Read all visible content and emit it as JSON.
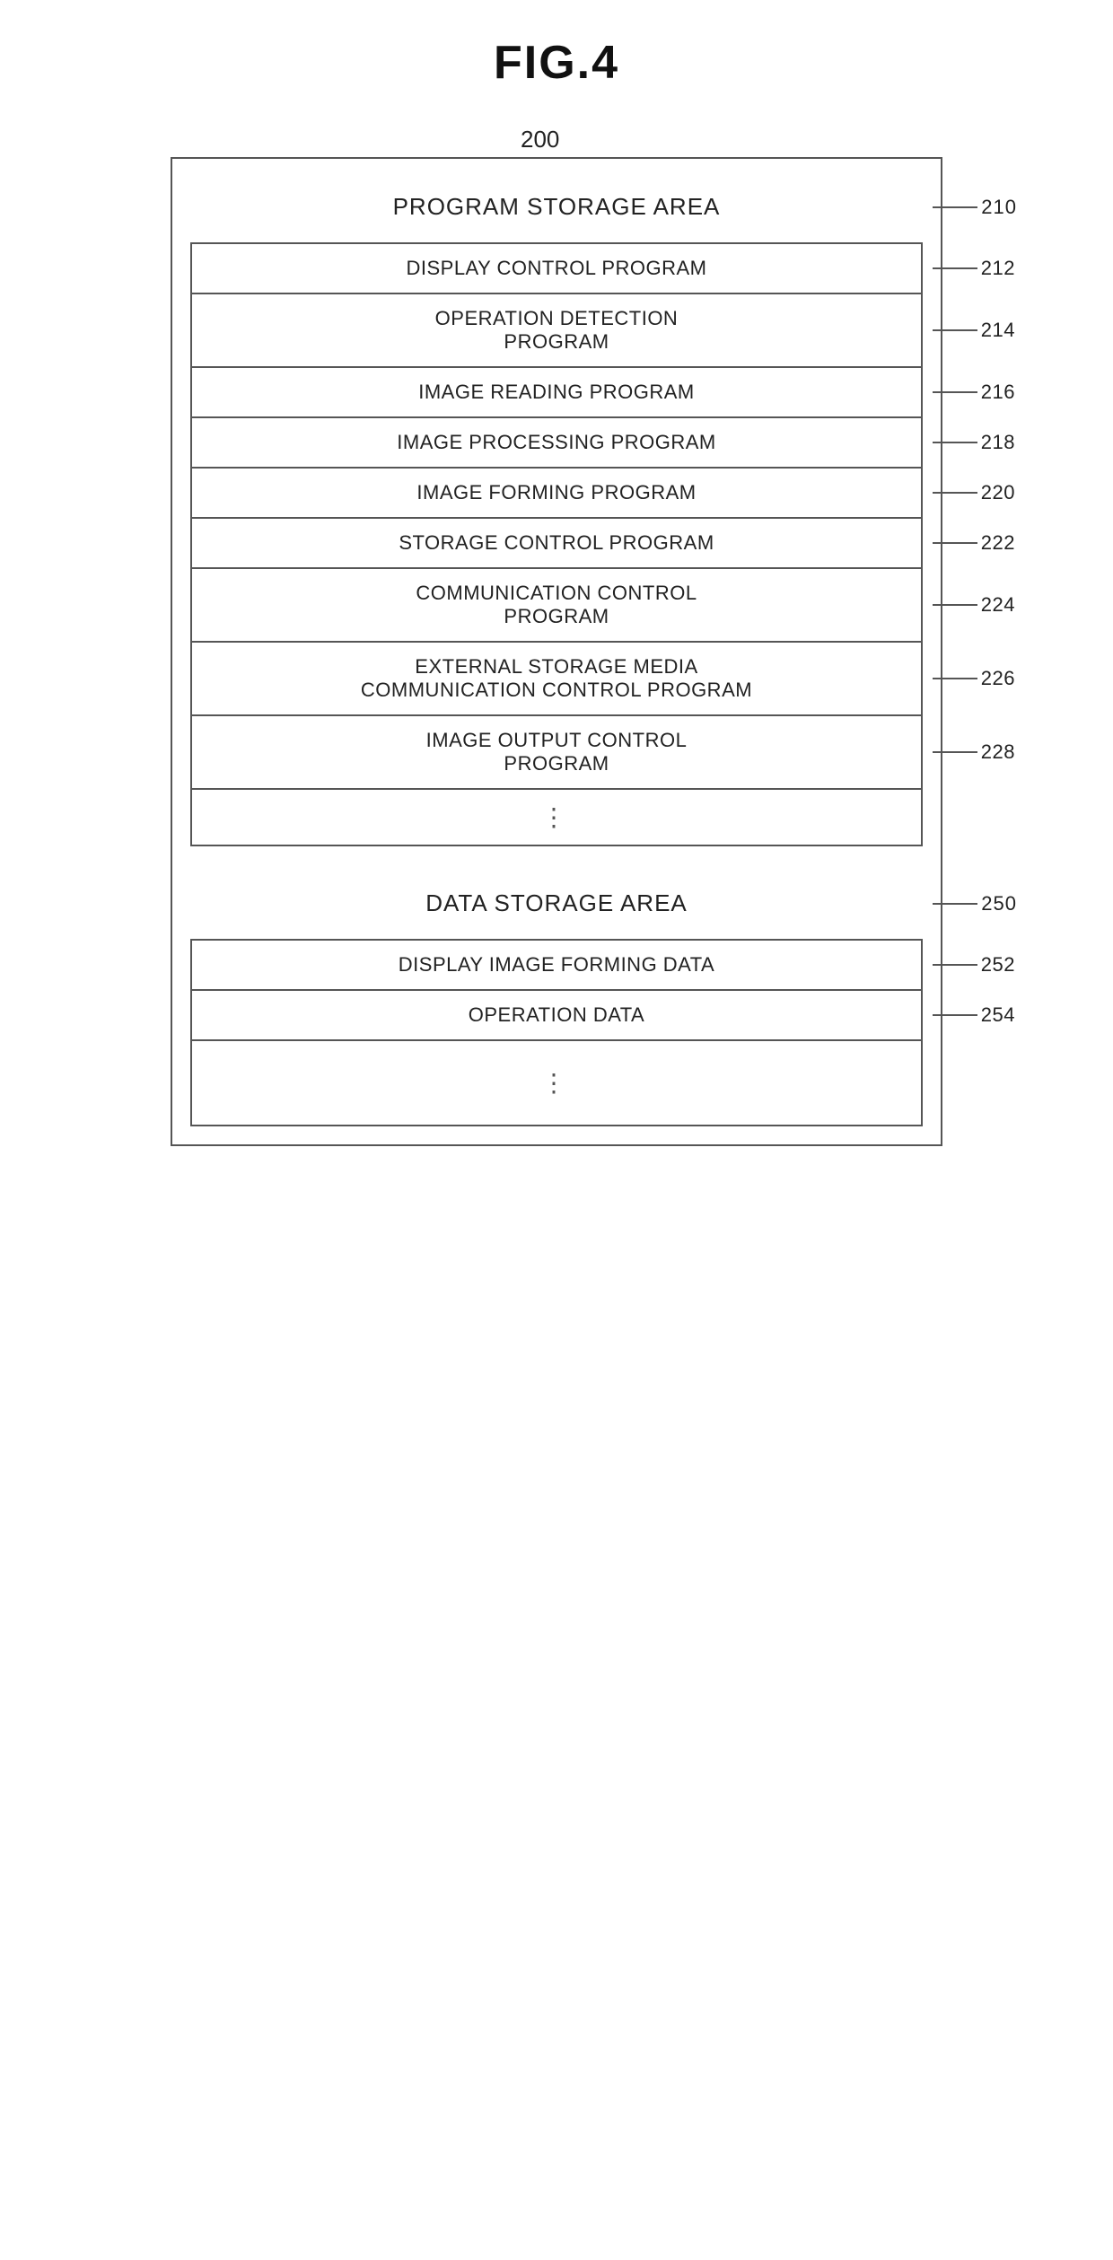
{
  "figure": {
    "title": "FIG.4"
  },
  "diagram": {
    "main_ref": "200",
    "program_storage": {
      "label": "PROGRAM STORAGE AREA",
      "ref": "210",
      "programs": [
        {
          "label": "DISPLAY CONTROL PROGRAM",
          "ref": "212"
        },
        {
          "label": "OPERATION DETECTION\nPROGRAM",
          "ref": "214"
        },
        {
          "label": "IMAGE READING PROGRAM",
          "ref": "216"
        },
        {
          "label": "IMAGE PROCESSING PROGRAM",
          "ref": "218"
        },
        {
          "label": "IMAGE FORMING PROGRAM",
          "ref": "220"
        },
        {
          "label": "STORAGE CONTROL PROGRAM",
          "ref": "222"
        },
        {
          "label": "COMMUNICATION CONTROL\nPROGRAM",
          "ref": "224"
        },
        {
          "label": "EXTERNAL STORAGE MEDIA\nCOMMUNICATION CONTROL PROGRAM",
          "ref": "226"
        },
        {
          "label": "IMAGE OUTPUT CONTROL\nPROGRAM",
          "ref": "228"
        }
      ],
      "dots": "⋮"
    },
    "data_storage": {
      "label": "DATA STORAGE AREA",
      "ref": "250",
      "items": [
        {
          "label": "DISPLAY IMAGE FORMING DATA",
          "ref": "252"
        },
        {
          "label": "OPERATION DATA",
          "ref": "254"
        }
      ],
      "dots": "⋮"
    }
  }
}
